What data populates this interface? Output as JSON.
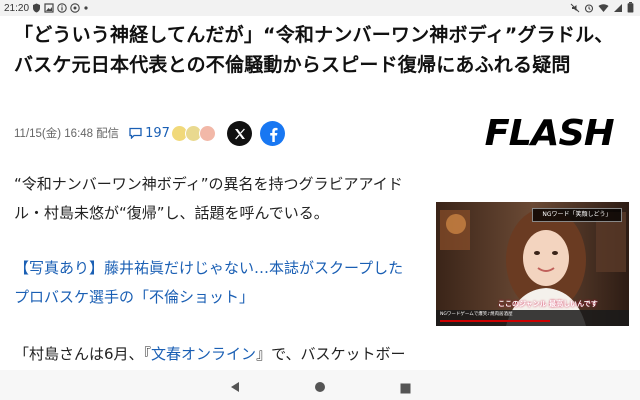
{
  "status_bar": {
    "time": "21:20",
    "left_icons": [
      "shield-icon",
      "image-icon",
      "info-icon",
      "chat-icon",
      "dot-icon"
    ],
    "right_icons": [
      "mute-icon",
      "alarm-icon",
      "wifi-icon",
      "signal-icon",
      "battery-icon"
    ]
  },
  "article": {
    "headline": "「どういう神経してんだが」“令和ナンバーワン神ボディ”グラドル、バスケ元日本代表との不倫騒動からスピード復帰にあふれる疑問",
    "date": "11/15(金) 16:48",
    "distribution_label": "配信",
    "comment_count": "197",
    "publisher_logo": "FLASH",
    "paragraphs": {
      "p1": "“令和ナンバーワン神ボディ”の異名を持つグラビアアイドル・村島未悠が“復帰”し、話題を呼んでいる。",
      "p2": "【写真あり】藤井祐眞だけじゃない…本誌がスクープしたプロバスケ選手の「不倫ショット」",
      "p3_before": "「村島さんは6月、『",
      "p3_link": "文春オンライン",
      "p3_after": "』で、バスケットボー"
    }
  },
  "photo": {
    "ng_caption": "NGワード「笑顔しどう」",
    "subtitle": "ここのジャンル 最高しいんです",
    "yt_title": "NGワードゲームで爆笑♪焼肉居酒屋"
  },
  "colors": {
    "link": "#1a5fb4",
    "facebook": "#1877f2",
    "x_brand": "#111111"
  },
  "nav": {
    "icons": [
      "back-icon",
      "home-icon",
      "recents-icon"
    ]
  }
}
